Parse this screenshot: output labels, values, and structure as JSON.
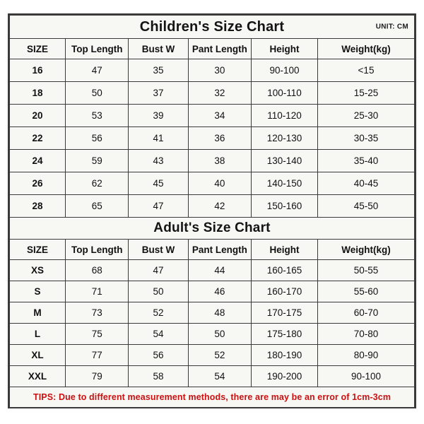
{
  "children": {
    "title": "Children's Size Chart",
    "unit_label": "UNIT: CM",
    "columns": [
      "SIZE",
      "Top Length",
      "Bust W",
      "Pant Length",
      "Height",
      "Weight(kg)"
    ],
    "rows": [
      [
        "16",
        "47",
        "35",
        "30",
        "90-100",
        "<15"
      ],
      [
        "18",
        "50",
        "37",
        "32",
        "100-110",
        "15-25"
      ],
      [
        "20",
        "53",
        "39",
        "34",
        "110-120",
        "25-30"
      ],
      [
        "22",
        "56",
        "41",
        "36",
        "120-130",
        "30-35"
      ],
      [
        "24",
        "59",
        "43",
        "38",
        "130-140",
        "35-40"
      ],
      [
        "26",
        "62",
        "45",
        "40",
        "140-150",
        "40-45"
      ],
      [
        "28",
        "65",
        "47",
        "42",
        "150-160",
        "45-50"
      ]
    ]
  },
  "adult": {
    "title": "Adult's Size Chart",
    "columns": [
      "SIZE",
      "Top Length",
      "Bust W",
      "Pant Length",
      "Height",
      "Weight(kg)"
    ],
    "rows": [
      [
        "XS",
        "68",
        "47",
        "44",
        "160-165",
        "50-55"
      ],
      [
        "S",
        "71",
        "50",
        "46",
        "160-170",
        "55-60"
      ],
      [
        "M",
        "73",
        "52",
        "48",
        "170-175",
        "60-70"
      ],
      [
        "L",
        "75",
        "54",
        "50",
        "175-180",
        "70-80"
      ],
      [
        "XL",
        "77",
        "56",
        "52",
        "180-190",
        "80-90"
      ],
      [
        "XXL",
        "79",
        "58",
        "54",
        "190-200",
        "90-100"
      ]
    ]
  },
  "footer": {
    "tips": "TIPS: Due to different measurement methods, there are may be an error of 1cm-3cm"
  },
  "colors": {
    "header_blue": "#11ace8",
    "cell_background": "#f7f7f4",
    "border": "#3a3a3a",
    "tips_red": "#cc1111",
    "text": "#111111"
  }
}
